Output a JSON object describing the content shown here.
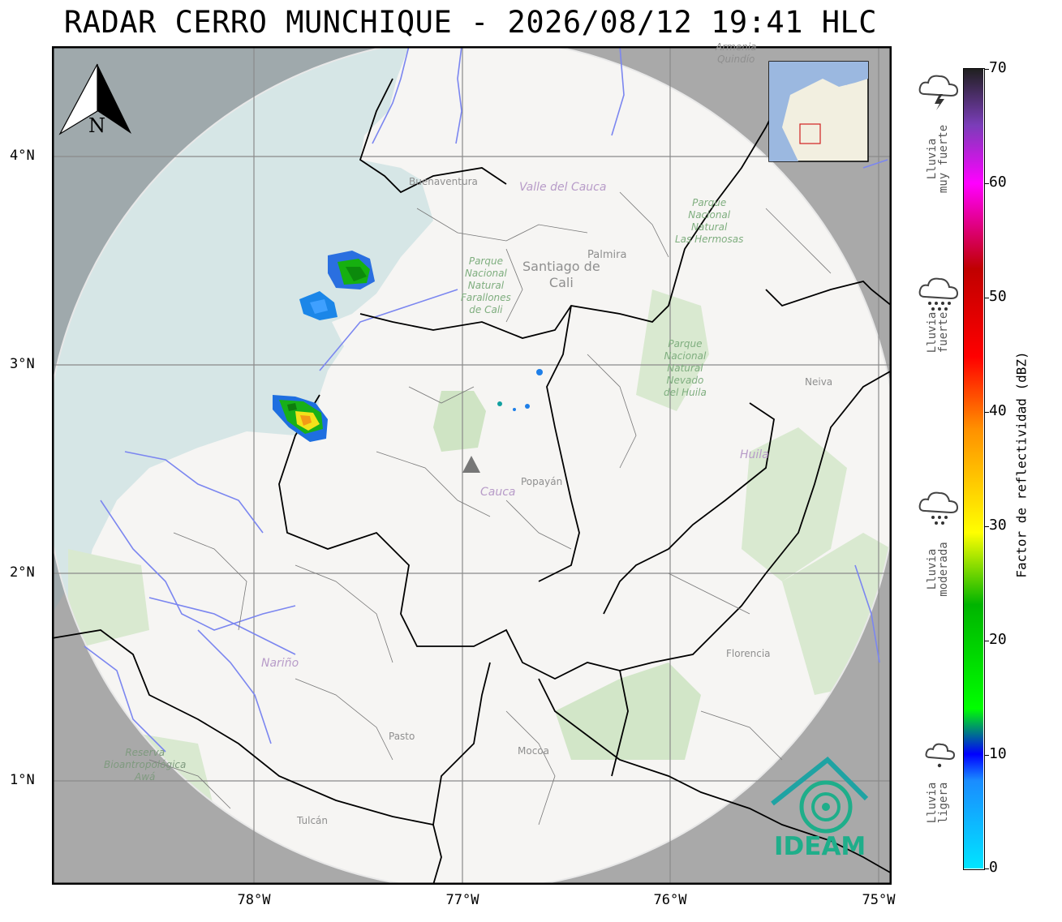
{
  "title": "RADAR CERRO MUNCHIQUE - 2026/08/12 19:41 HLC",
  "north_arrow_label": "N",
  "lat_ticks": [
    "4°N",
    "3°N",
    "2°N",
    "1°N"
  ],
  "lon_ticks": [
    "78°W",
    "77°W",
    "76°W",
    "75°W"
  ],
  "colorbar": {
    "label": "Factor de reflectividad (dBZ)",
    "ticks": [
      "70",
      "60",
      "50",
      "40",
      "30",
      "20",
      "10",
      "0"
    ],
    "min": 0,
    "max": 70
  },
  "rain_categories": [
    {
      "label": "Lluvia\nmuy fuerte",
      "icon": "thunderstorm-cloud-icon"
    },
    {
      "label": "Lluvia\nfuerte",
      "icon": "heavy-rain-cloud-icon"
    },
    {
      "label": "Lluvia\nmoderada",
      "icon": "moderate-rain-cloud-icon"
    },
    {
      "label": "Lluvia\nligera",
      "icon": "light-rain-cloud-icon"
    }
  ],
  "logo_text": "IDEAM",
  "map_labels": {
    "santiago": "Santiago de\nCali",
    "palmira": "Palmira",
    "valle": "Valle del Cauca",
    "buenaventura": "Buenaventura",
    "cauca": "Cauca",
    "popayan": "Popayán",
    "huila": "Huila",
    "neiva": "Neiva",
    "florencia": "Florencia",
    "narino": "Nariño",
    "pasto": "Pasto",
    "mocoa": "Mocoa",
    "tulcan": "Tulcán",
    "farallones": "Parque\nNacional\nNatural\nFarallones\nde Cali",
    "hermosas": "Parque\nNacional\nNatural\nLas Hermosas",
    "nevado": "Parque\nNacional\nNatural\nNevado\ndel Huila",
    "awa": "Reserva\nBioantropológica\nAwá",
    "quindio": "Armenia\nQuindío"
  },
  "colors": {
    "sea": "#d6e6e6",
    "land": "#f6f5f3",
    "outside_range": "#b8b8b8",
    "rivers": "#7b86f0",
    "borders": "#000000",
    "logo": "#1fae8a"
  }
}
